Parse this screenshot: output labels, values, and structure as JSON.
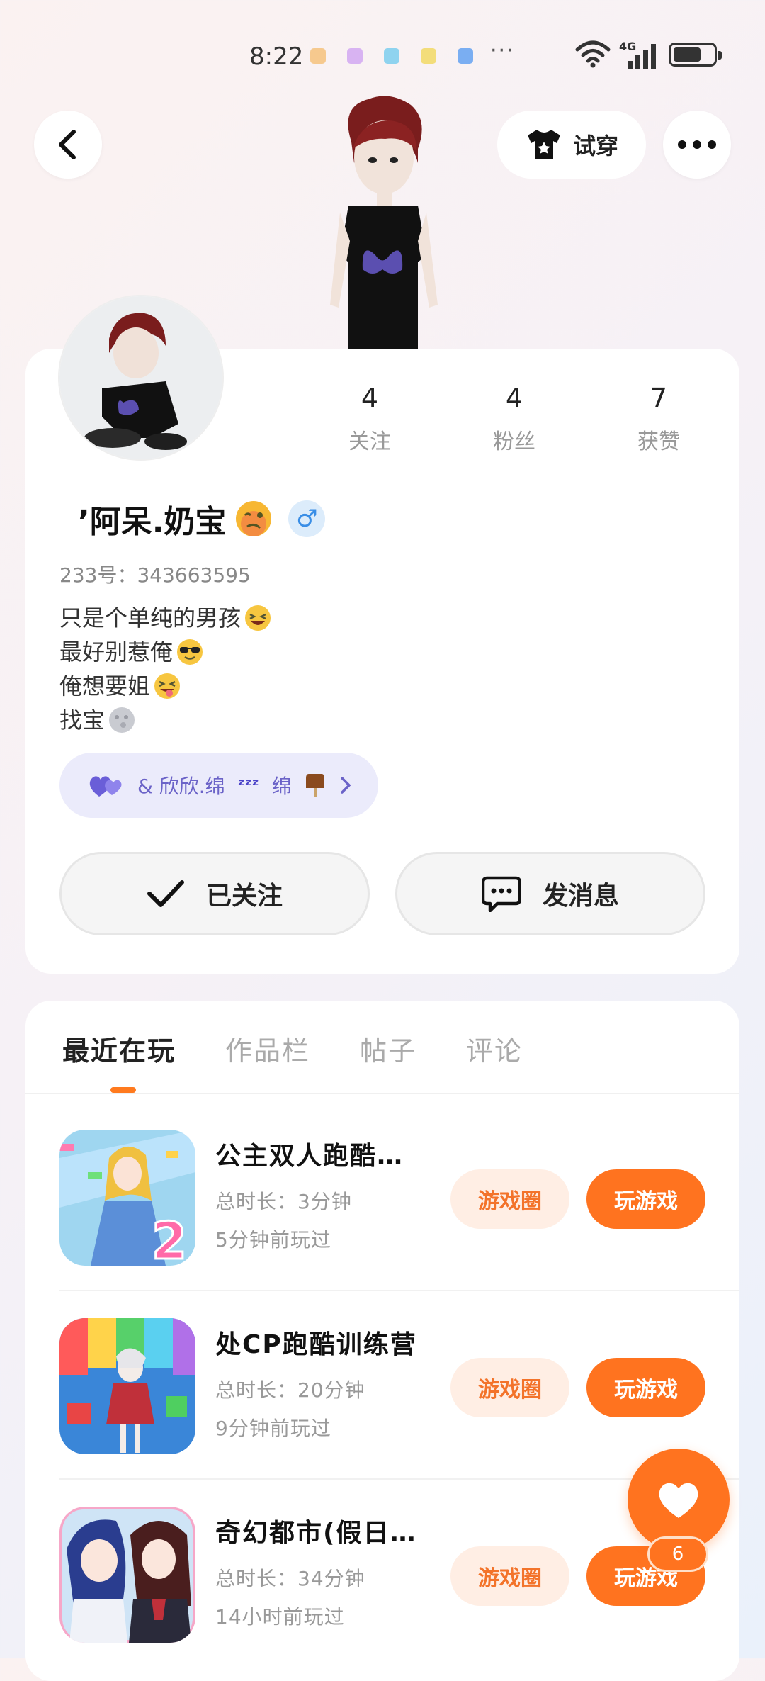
{
  "status_bar": {
    "time": "8:22",
    "network": "4G",
    "more": "···"
  },
  "header": {
    "try_on_label": "试穿"
  },
  "profile": {
    "stats": [
      {
        "num": "4",
        "label": "关注"
      },
      {
        "num": "4",
        "label": "粉丝"
      },
      {
        "num": "7",
        "label": "获赞"
      }
    ],
    "username": "’阿呆.奶宝",
    "gender_symbol": "♂",
    "uid": "233号：343663595",
    "bio": [
      "只是个单纯的男孩",
      "最好别惹俺",
      "俺想要姐",
      "找宝"
    ],
    "cp_label": "& 欣欣.绵",
    "cp_suffix": "绵",
    "follow_label": "已关注",
    "message_label": "发消息"
  },
  "tabs": [
    "最近在玩",
    "作品栏",
    "帖子",
    "评论"
  ],
  "games": [
    {
      "title": "公主双人跑酷…",
      "duration": "总时长：3分钟",
      "last_played": "5分钟前玩过",
      "circle_label": "游戏圈",
      "play_label": "玩游戏"
    },
    {
      "title": "处CP跑酷训练营",
      "duration": "总时长：20分钟",
      "last_played": "9分钟前玩过",
      "circle_label": "游戏圈",
      "play_label": "玩游戏"
    },
    {
      "title": "奇幻都市(假日…",
      "duration": "总时长：34分钟",
      "last_played": "14小时前玩过",
      "circle_label": "游戏圈",
      "play_label": "玩游戏"
    }
  ],
  "like_fab": {
    "count": "6"
  },
  "colors": {
    "accent": "#ff731f",
    "accent_light": "#ffeee4",
    "cp_bg": "#ebebfb"
  },
  "icons": [
    "back-icon",
    "tshirt-icon",
    "more-icon",
    "checkmark-icon",
    "chat-icon",
    "heart-icon",
    "chevron-right-icon"
  ]
}
